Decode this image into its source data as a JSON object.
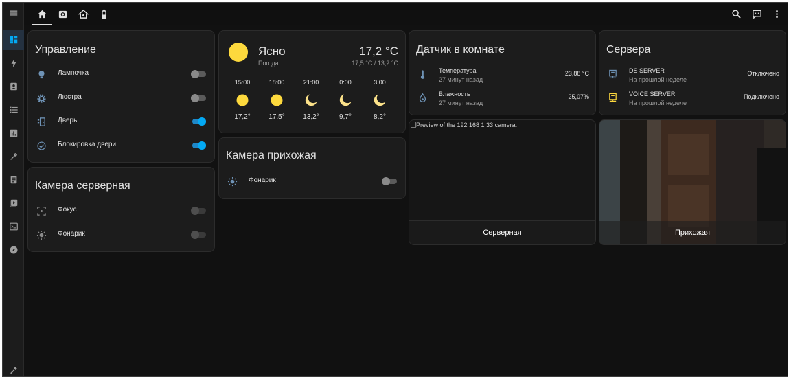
{
  "topbar": {
    "tabs": [
      {
        "icon": "home-icon",
        "active": true
      },
      {
        "icon": "camera-icon",
        "active": false
      },
      {
        "icon": "home-automation-icon",
        "active": false
      },
      {
        "icon": "battery-icon",
        "active": false
      }
    ],
    "actions": [
      "search-icon",
      "assist-icon",
      "more-vert-icon"
    ]
  },
  "sidebar": {
    "items": [
      "menu-icon",
      "dashboard-icon",
      "energy-icon",
      "map-icon",
      "logbook-icon",
      "history-icon",
      "tools-icon",
      "server-icon",
      "media-icon",
      "terminal-icon",
      "compass-icon"
    ],
    "bottom": "settings-hammer-icon"
  },
  "control_card": {
    "title": "Управление",
    "rows": [
      {
        "label": "Лампочка",
        "icon": "bulb-icon",
        "on": false
      },
      {
        "label": "Люстра",
        "icon": "gear-icon",
        "on": false
      },
      {
        "label": "Дверь",
        "icon": "door-icon",
        "on": true
      },
      {
        "label": "Блокировка двери",
        "icon": "check-circle-icon",
        "on": true
      }
    ]
  },
  "server_cam_card": {
    "title": "Камера серверная",
    "rows": [
      {
        "label": "Фокус",
        "icon": "focus-icon",
        "on": false
      },
      {
        "label": "Фонарик",
        "icon": "flashlight-icon",
        "on": false
      }
    ]
  },
  "weather": {
    "condition": "Ясно",
    "source": "Погода",
    "temp": "17,2 °C",
    "range": "17,5 °C / 13,2 °C",
    "forecast": [
      {
        "time": "15:00",
        "icon": "sun",
        "temp": "17,2°"
      },
      {
        "time": "18:00",
        "icon": "sun",
        "temp": "17,5°"
      },
      {
        "time": "21:00",
        "icon": "moon",
        "temp": "13,2°"
      },
      {
        "time": "0:00",
        "icon": "moon",
        "temp": "9,7°"
      },
      {
        "time": "3:00",
        "icon": "moon",
        "temp": "8,2°"
      }
    ]
  },
  "hall_cam_card": {
    "title": "Камера прихожая",
    "rows": [
      {
        "label": "Фонарик",
        "icon": "flashlight-icon",
        "on": false
      }
    ]
  },
  "sensor_card": {
    "title": "Датчик в комнате",
    "rows": [
      {
        "label": "Температура",
        "sub": "27 минут назад",
        "value": "23,88 °C",
        "icon": "thermometer-icon"
      },
      {
        "label": "Влажность",
        "sub": "27 минут назад",
        "value": "25,07%",
        "icon": "water-icon"
      }
    ]
  },
  "servers_card": {
    "title": "Сервера",
    "rows": [
      {
        "label": "DS SERVER",
        "sub": "На прошлой неделе",
        "value": "Отключено",
        "icon": "server-blue-icon"
      },
      {
        "label": "VOICE SERVER",
        "sub": "На прошлой неделе",
        "value": "Подключено",
        "icon": "server-yellow-icon"
      }
    ]
  },
  "camera_server": {
    "alt": "Preview of the 192 168 1 33 camera.",
    "name": "Серверная"
  },
  "camera_hall": {
    "name": "Прихожая"
  },
  "colors": {
    "accent": "#03a9f4",
    "sun": "#fdd93d",
    "bg": "#111111",
    "card": "#1c1c1c"
  }
}
